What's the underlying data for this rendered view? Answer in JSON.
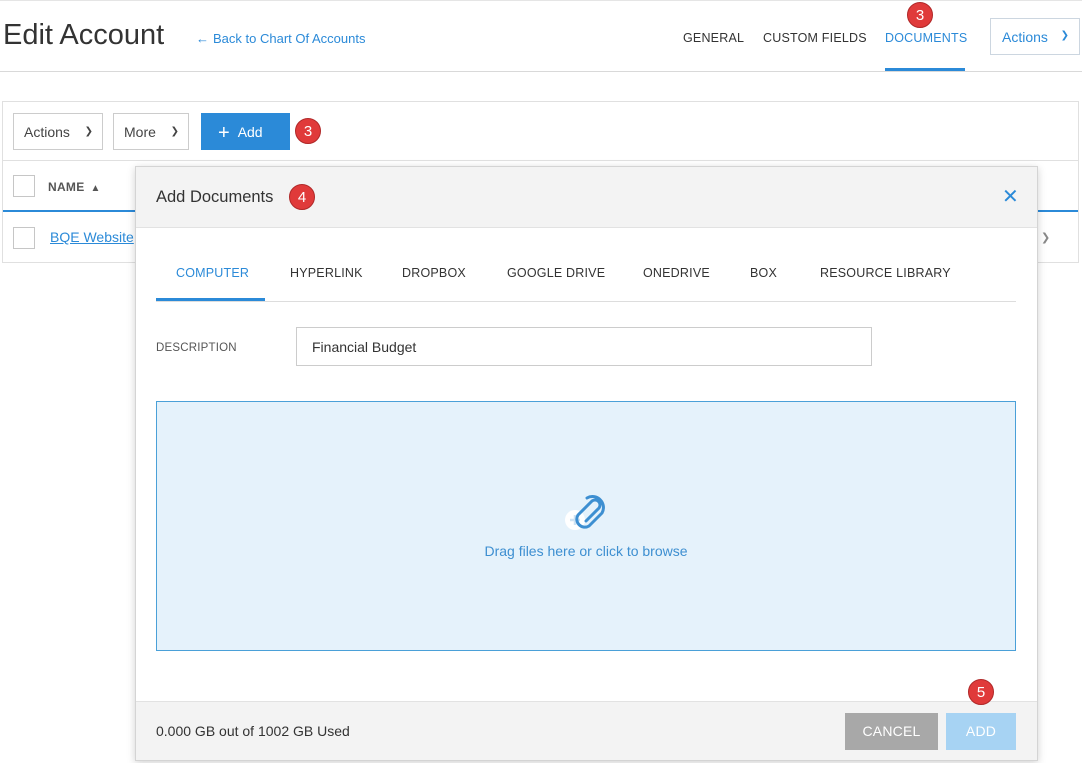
{
  "header": {
    "title": "Edit Account",
    "back_link": "Back to Chart Of Accounts",
    "tabs": [
      {
        "label": "GENERAL"
      },
      {
        "label": "CUSTOM FIELDS"
      },
      {
        "label": "DOCUMENTS",
        "active": true
      }
    ],
    "actions_label": "Actions"
  },
  "toolbar": {
    "actions_label": "Actions",
    "more_label": "More",
    "add_label": "Add"
  },
  "grid": {
    "columns": [
      {
        "label": "NAME",
        "sort": "ascending"
      }
    ],
    "rows": [
      {
        "name": "BQE Website"
      }
    ]
  },
  "dialog": {
    "title": "Add Documents",
    "tabs": [
      {
        "label": "COMPUTER",
        "active": true
      },
      {
        "label": "HYPERLINK"
      },
      {
        "label": "DROPBOX"
      },
      {
        "label": "GOOGLE DRIVE"
      },
      {
        "label": "ONEDRIVE"
      },
      {
        "label": "BOX"
      },
      {
        "label": "RESOURCE LIBRARY"
      }
    ],
    "description_label": "DESCRIPTION",
    "description_value": "Financial Budget",
    "dropzone_text": "Drag files here or click to browse",
    "storage_text": "0.000 GB out of 1002 GB Used",
    "cancel_label": "CANCEL",
    "add_label": "ADD"
  },
  "annotations": [
    "3",
    "3",
    "4",
    "5"
  ],
  "colors": {
    "accent": "#2b8ad8",
    "badge": "#e03a3a",
    "dropzone_bg": "#e5f2fb",
    "cancel_bg": "#a8a8a8",
    "add_disabled_bg": "#a7d3f3"
  }
}
